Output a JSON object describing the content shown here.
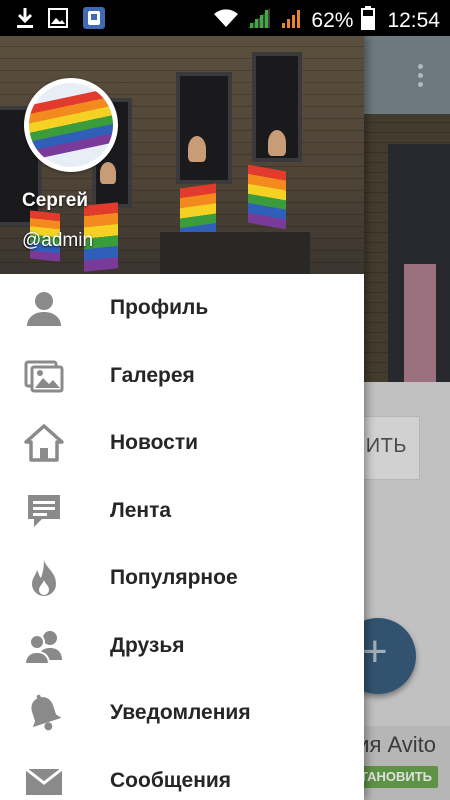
{
  "status_bar": {
    "battery_percent": "62%",
    "time": "12:54",
    "icons": [
      "download-icon",
      "image-icon",
      "app-notification-icon",
      "wifi-icon",
      "signal-green-icon",
      "signal-orange-icon",
      "battery-icon"
    ]
  },
  "drawer": {
    "header": {
      "user_name": "Сергей",
      "user_handle": "@admin",
      "avatar": "rainbow-flag-avatar"
    },
    "menu": [
      {
        "label": "Профиль",
        "icon": "person-icon"
      },
      {
        "label": "Галерея",
        "icon": "gallery-icon"
      },
      {
        "label": "Новости",
        "icon": "home-icon"
      },
      {
        "label": "Лента",
        "icon": "chat-bubble-icon"
      },
      {
        "label": "Популярное",
        "icon": "fire-icon"
      },
      {
        "label": "Друзья",
        "icon": "friends-icon"
      },
      {
        "label": "Уведомления",
        "icon": "bell-icon"
      },
      {
        "label": "Сообщения",
        "icon": "mail-icon"
      }
    ]
  },
  "background": {
    "button_text": "ИТЬ",
    "fab_symbol": "+",
    "ad_title": "ия Avito",
    "ad_install": "ТАНОВИТЬ"
  },
  "colors": {
    "icon_gray": "#8a8a8a",
    "label_text": "#262626",
    "toolbar": "#7d8a90",
    "fab": "#3a5f80",
    "install_green": "#6aa84f"
  }
}
